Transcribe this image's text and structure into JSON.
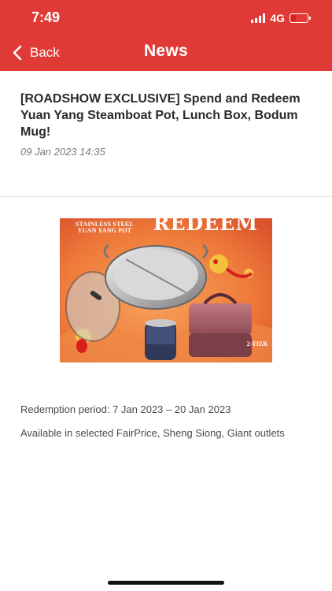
{
  "status_bar": {
    "time": "7:49",
    "network": "4G"
  },
  "header": {
    "title": "News",
    "back_label": "Back"
  },
  "article": {
    "title": "[ROADSHOW EXCLUSIVE] Spend and Redeem Yuan Yang Steamboat Pot, Lunch Box, Bodum Mug!",
    "date": "09 Jan 2023 14:35",
    "banner": {
      "label_left": "STAINLESS STEEL YUAN YANG POT",
      "label_redeem": "REDEEM",
      "label_tier": "2-TIER"
    },
    "info": [
      "Redemption period: 7 Jan 2023 – 20 Jan 2023",
      "Available in selected FairPrice, Sheng Siong, Giant outlets"
    ]
  },
  "colors": {
    "brand_red": "#e03a36",
    "banner_orange": "#ee7a3a"
  }
}
